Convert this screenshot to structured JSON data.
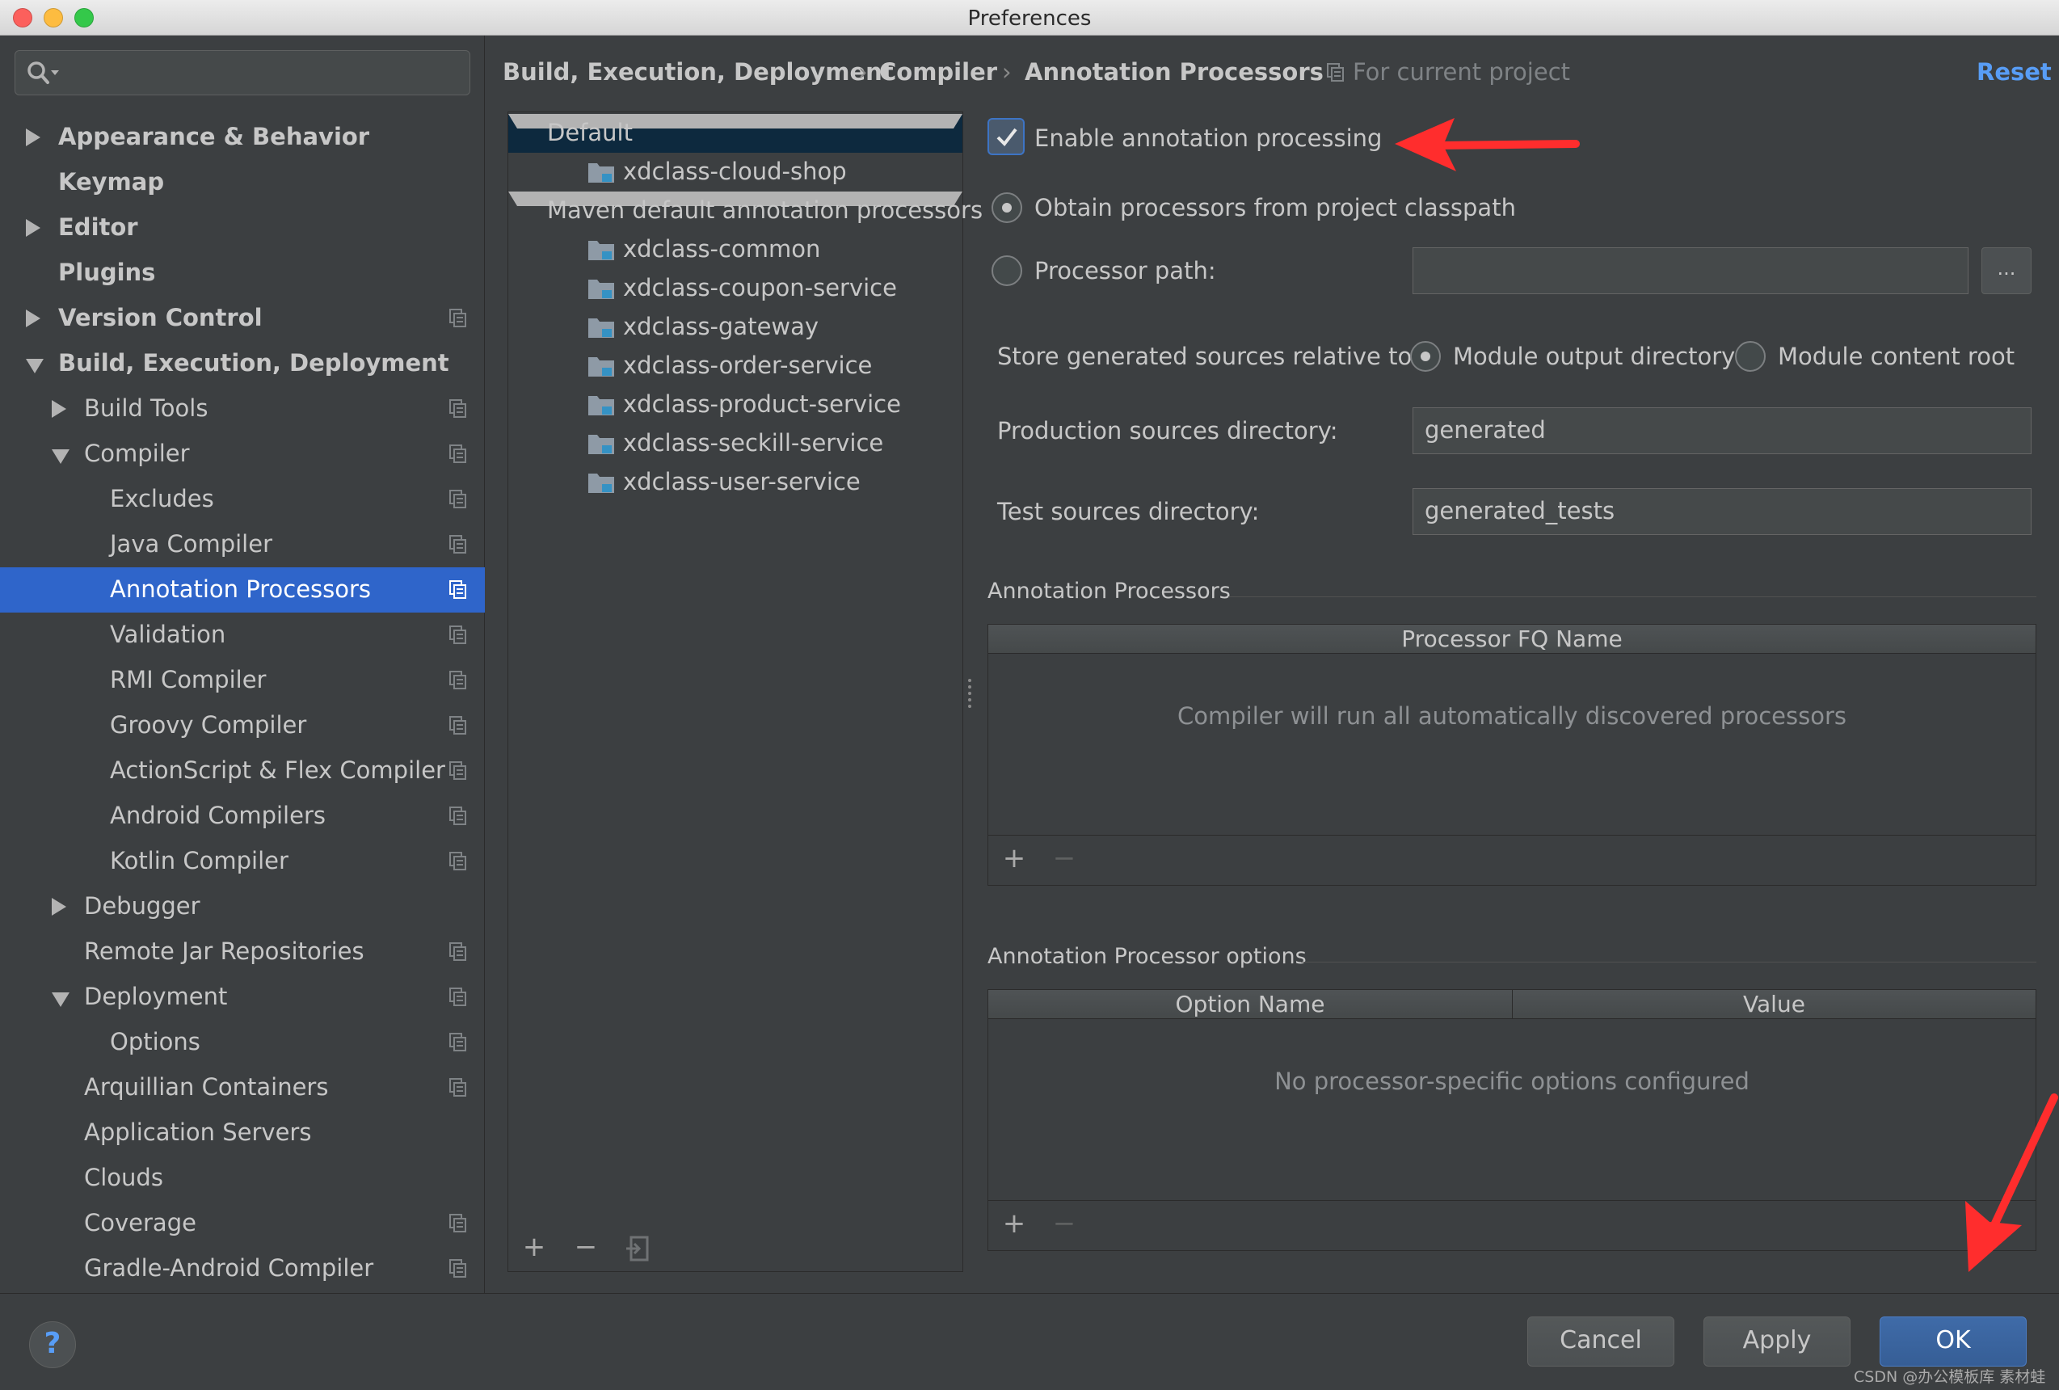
{
  "window": {
    "title": "Preferences"
  },
  "sidebar": {
    "search_placeholder": "",
    "items": [
      {
        "label": "Appearance & Behavior",
        "bold": true,
        "arrow": "right",
        "level": 0
      },
      {
        "label": "Keymap",
        "bold": true,
        "arrow": "none",
        "level": 0
      },
      {
        "label": "Editor",
        "bold": true,
        "arrow": "right",
        "level": 0
      },
      {
        "label": "Plugins",
        "bold": true,
        "arrow": "none",
        "level": 0
      },
      {
        "label": "Version Control",
        "bold": true,
        "arrow": "right",
        "level": 0,
        "project": true
      },
      {
        "label": "Build, Execution, Deployment",
        "bold": true,
        "arrow": "down",
        "level": 0
      },
      {
        "label": "Build Tools",
        "arrow": "right",
        "level": 1,
        "project": true
      },
      {
        "label": "Compiler",
        "arrow": "down",
        "level": 1,
        "project": true
      },
      {
        "label": "Excludes",
        "arrow": "none",
        "level": 2,
        "project": true
      },
      {
        "label": "Java Compiler",
        "arrow": "none",
        "level": 2,
        "project": true
      },
      {
        "label": "Annotation Processors",
        "arrow": "none",
        "level": 2,
        "project": true,
        "selected": true
      },
      {
        "label": "Validation",
        "arrow": "none",
        "level": 2,
        "project": true
      },
      {
        "label": "RMI Compiler",
        "arrow": "none",
        "level": 2,
        "project": true
      },
      {
        "label": "Groovy Compiler",
        "arrow": "none",
        "level": 2,
        "project": true
      },
      {
        "label": "ActionScript & Flex Compiler",
        "arrow": "none",
        "level": 2,
        "project": true
      },
      {
        "label": "Android Compilers",
        "arrow": "none",
        "level": 2,
        "project": true
      },
      {
        "label": "Kotlin Compiler",
        "arrow": "none",
        "level": 2,
        "project": true
      },
      {
        "label": "Debugger",
        "arrow": "right",
        "level": 1
      },
      {
        "label": "Remote Jar Repositories",
        "arrow": "none",
        "level": 1,
        "project": true
      },
      {
        "label": "Deployment",
        "arrow": "down",
        "level": 1,
        "project": true
      },
      {
        "label": "Options",
        "arrow": "none",
        "level": 2,
        "project": true
      },
      {
        "label": "Arquillian Containers",
        "arrow": "none",
        "level": 1,
        "project": true
      },
      {
        "label": "Application Servers",
        "arrow": "none",
        "level": 1
      },
      {
        "label": "Clouds",
        "arrow": "none",
        "level": 1
      },
      {
        "label": "Coverage",
        "arrow": "none",
        "level": 1,
        "project": true
      },
      {
        "label": "Gradle-Android Compiler",
        "arrow": "none",
        "level": 1,
        "project": true
      }
    ]
  },
  "breadcrumb": {
    "parts": [
      "Build, Execution, Deployment",
      "Compiler",
      "Annotation Processors"
    ],
    "separator": "›",
    "scope": "For current project",
    "reset": "Reset"
  },
  "profiles": {
    "items": [
      {
        "label": "Default",
        "type": "group",
        "selected": true
      },
      {
        "label": "xdclass-cloud-shop",
        "type": "module"
      },
      {
        "label": "Maven default annotation processors",
        "type": "group"
      },
      {
        "label": "xdclass-common",
        "type": "module"
      },
      {
        "label": "xdclass-coupon-service",
        "type": "module"
      },
      {
        "label": "xdclass-gateway",
        "type": "module"
      },
      {
        "label": "xdclass-order-service",
        "type": "module"
      },
      {
        "label": "xdclass-product-service",
        "type": "module"
      },
      {
        "label": "xdclass-seckill-service",
        "type": "module"
      },
      {
        "label": "xdclass-user-service",
        "type": "module"
      }
    ],
    "toolbar": {
      "add": "+",
      "remove": "−"
    }
  },
  "settings": {
    "enable_label": "Enable annotation processing",
    "enable_checked": true,
    "obtain_label": "Obtain processors from project classpath",
    "processor_path_label": "Processor path:",
    "processor_path_value": "",
    "browse_label": "...",
    "store_label": "Store generated sources relative to:",
    "module_output_label": "Module output directory",
    "module_content_label": "Module content root",
    "production_label": "Production sources directory:",
    "production_value": "generated",
    "test_label": "Test sources directory:",
    "test_value": "generated_tests"
  },
  "processors_section": {
    "title": "Annotation Processors",
    "column": "Processor FQ Name",
    "empty_text": "Compiler will run all automatically discovered processors",
    "add": "+",
    "remove": "−"
  },
  "options_section": {
    "title": "Annotation Processor options",
    "columns": [
      "Option Name",
      "Value"
    ],
    "empty_text": "No processor-specific options configured",
    "add": "+",
    "remove": "−"
  },
  "buttons": {
    "help": "?",
    "cancel": "Cancel",
    "apply": "Apply",
    "ok": "OK"
  },
  "watermark": "CSDN @办公模板库 素材蛙",
  "colors": {
    "accent": "#2f65ca",
    "link": "#589df6",
    "arrow": "#ff2d2d",
    "bg": "#3c3f41"
  }
}
